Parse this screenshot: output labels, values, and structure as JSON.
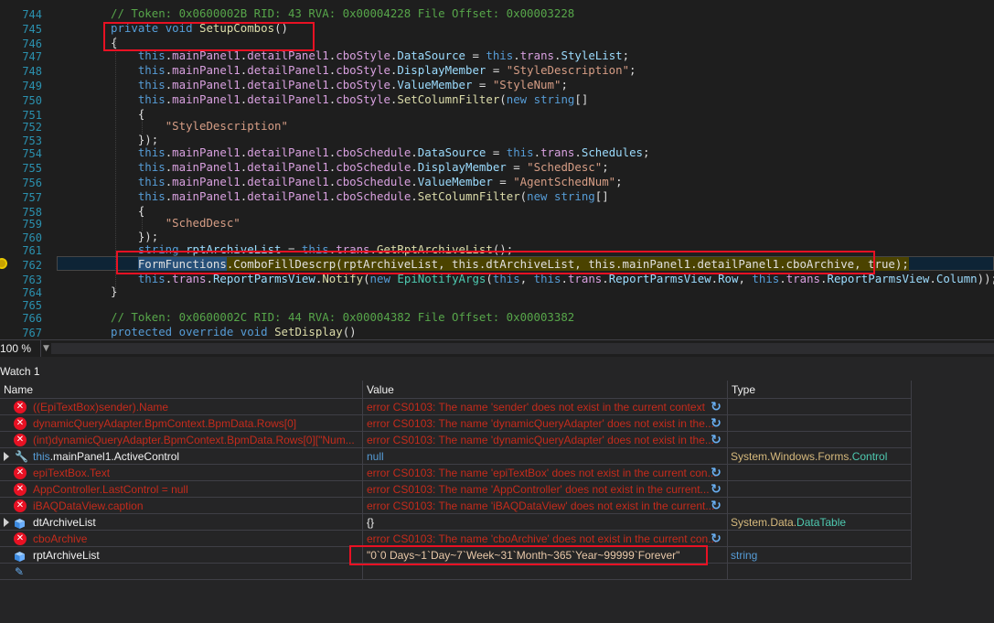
{
  "editor": {
    "line_numbers": [
      "744",
      "745",
      "746",
      "747",
      "748",
      "749",
      "750",
      "751",
      "752",
      "753",
      "754",
      "755",
      "756",
      "757",
      "758",
      "759",
      "760",
      "761",
      "762",
      "763",
      "764",
      "765",
      "766",
      "767"
    ],
    "lines": [
      "// Token: 0x0600002B RID: 43 RVA: 0x00004228 File Offset: 0x00003228",
      "private void SetupCombos()",
      "{",
      "    this.mainPanel1.detailPanel1.cboStyle.DataSource = this.trans.StyleList;",
      "    this.mainPanel1.detailPanel1.cboStyle.DisplayMember = \"StyleDescription\";",
      "    this.mainPanel1.detailPanel1.cboStyle.ValueMember = \"StyleNum\";",
      "    this.mainPanel1.detailPanel1.cboStyle.SetColumnFilter(new string[]",
      "    {",
      "        \"StyleDescription\"",
      "    });",
      "    this.mainPanel1.detailPanel1.cboSchedule.DataSource = this.trans.Schedules;",
      "    this.mainPanel1.detailPanel1.cboSchedule.DisplayMember = \"SchedDesc\";",
      "    this.mainPanel1.detailPanel1.cboSchedule.ValueMember = \"AgentSchedNum\";",
      "    this.mainPanel1.detailPanel1.cboSchedule.SetColumnFilter(new string[]",
      "    {",
      "        \"SchedDesc\"",
      "    });",
      "    string rptArchiveList = this.trans.GetRptArchiveList();",
      "    FormFunctions.ComboFillDescrp(rptArchiveList, this.dtArchiveList, this.mainPanel1.detailPanel1.cboArchive, true);",
      "    this.trans.ReportParmsView.Notify(new EpiNotifyArgs(this, this.trans.ReportParmsView.Row, this.trans.ReportParmsView.Column));",
      "}",
      "",
      "// Token: 0x0600002C RID: 44 RVA: 0x00004382 File Offset: 0x00003382",
      "protected override void SetDisplay()"
    ]
  },
  "zoom": {
    "label": "100 %"
  },
  "watch": {
    "title": "Watch 1",
    "columns": [
      "Name",
      "Value",
      "Type"
    ],
    "rows": [
      {
        "name": "((EpiTextBox)sender).Name",
        "value": "error CS0103: The name 'sender' does not exist in the current context",
        "type": ""
      },
      {
        "name": "dynamicQueryAdapter.BpmContext.BpmData.Rows[0]",
        "value": "error CS0103: The name 'dynamicQueryAdapter' does not exist in the...",
        "type": ""
      },
      {
        "name": "(int)dynamicQueryAdapter.BpmContext.BpmData.Rows[0][\"Num...",
        "value": "error CS0103: The name 'dynamicQueryAdapter' does not exist in the...",
        "type": ""
      },
      {
        "name_prefix": "this",
        "name": ".mainPanel1.ActiveControl",
        "value": "null",
        "type_ns": "System.Windows.Forms.",
        "type": "Control"
      },
      {
        "name": "epiTextBox.Text",
        "value": "error CS0103: The name 'epiTextBox' does not exist in the current con...",
        "type": ""
      },
      {
        "name": "AppController.LastControl = null",
        "value": "error CS0103: The name 'AppController' does not exist in the current...",
        "type": ""
      },
      {
        "name": "iBAQDataView.caption",
        "value": "error CS0103: The name 'iBAQDataView' does not exist in the current...",
        "type": ""
      },
      {
        "name": "dtArchiveList",
        "value": "{}",
        "type_ns": "System.Data.",
        "type": "DataTable"
      },
      {
        "name": "cboArchive",
        "value": "error CS0103: The name 'cboArchive' does not exist in the current con...",
        "type": ""
      },
      {
        "name": "rptArchiveList",
        "value": "\"0`0 Days~1`Day~7`Week~31`Month~365`Year~99999`Forever\"",
        "type": "string"
      }
    ]
  },
  "colors": {
    "error_red": "#c42b1c",
    "highlight_box": "#e81123",
    "keyword": "#569cd6",
    "type": "#4ec9b0"
  }
}
